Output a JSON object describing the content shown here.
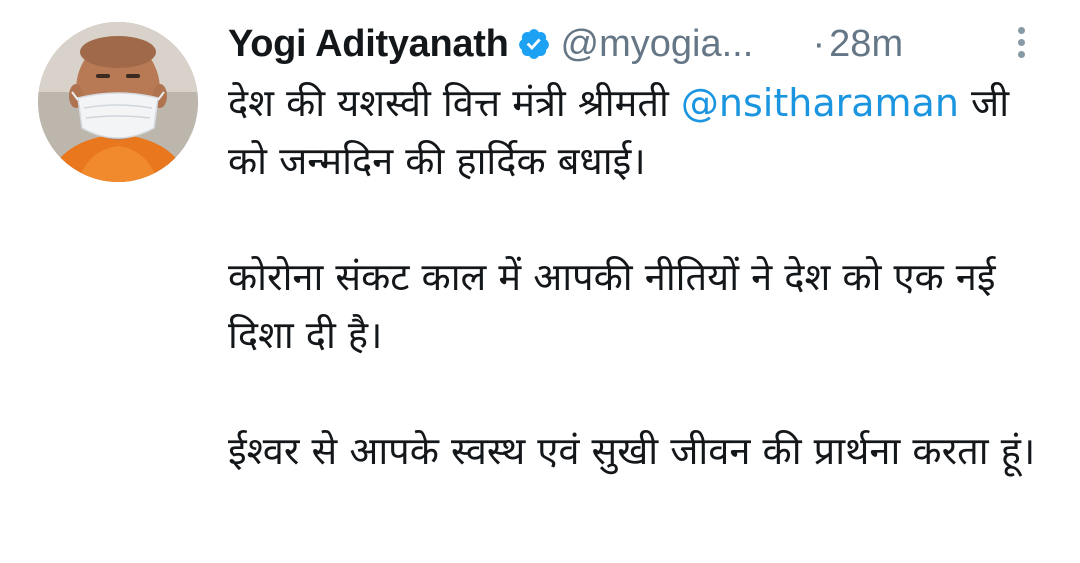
{
  "tweet": {
    "display_name": "Yogi Adityanath",
    "verified_icon": "verified-badge-icon",
    "handle": "@myogia...",
    "separator": "·",
    "timestamp": "28m",
    "more_icon": "more-vertical-icon",
    "avatar_icon": "profile-photo",
    "colors": {
      "mention": "#1b95e0",
      "muted": "#657786",
      "verified": "#1da1f2",
      "text": "#14171a"
    },
    "text": {
      "p1_before": "देश की यशस्वी वित्त मंत्री श्रीमती ",
      "p1_mention": "@nsitharaman",
      "p1_after": " जी को जन्मदिन की हार्दिक बधाई।",
      "p2": "कोरोना संकट काल में आपकी नीतियों ने देश को एक नई दिशा दी है।",
      "p3": "ईश्वर से आपके स्वस्थ एवं सुखी जीवन की प्रार्थना करता हूं।"
    }
  }
}
